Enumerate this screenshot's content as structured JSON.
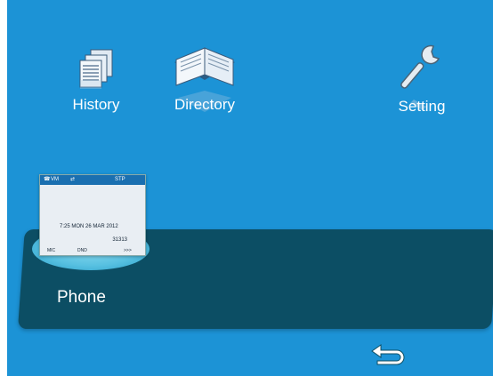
{
  "apps": {
    "history": {
      "label": "History",
      "icon": "history-documents-icon"
    },
    "directory": {
      "label": "Directory",
      "icon": "directory-book-icon"
    },
    "setting": {
      "label": "Setting",
      "icon": "wrench-icon"
    },
    "phone": {
      "label": "Phone"
    }
  },
  "phone_preview": {
    "status_left": "VM",
    "status_right": "STP",
    "datetime": "7:25  MON  26  MAR  2012",
    "number": "31313",
    "softkeys": [
      "MIC",
      "DND",
      ">>>"
    ]
  },
  "nav": {
    "back_icon": "back-arrow-icon"
  },
  "colors": {
    "background": "#1c93d6",
    "dock": "#0c4e64",
    "highlight": "#8fe0f5"
  }
}
